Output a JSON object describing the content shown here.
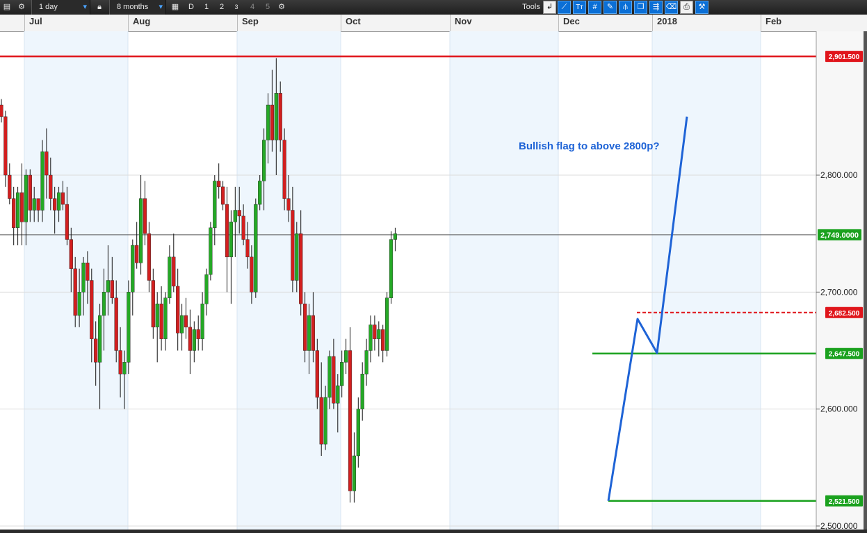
{
  "toolbar": {
    "interval": "1 day",
    "range": "8 months",
    "btn_d": "D",
    "btn_1": "1",
    "btn_2": "2",
    "btn_3": "3",
    "btn_4": "4",
    "btn_5": "5",
    "tools_label": "Tools",
    "text_tool": "Tт"
  },
  "chart_data": {
    "type": "candlestick",
    "title": "",
    "annotation": "Bullish flag to above 2800p?",
    "months": [
      "Jul",
      "Aug",
      "Sep",
      "Oct",
      "Nov",
      "Dec",
      "2018",
      "Feb"
    ],
    "y_ticks": [
      "2,800.000",
      "2,700.000",
      "2,600.000",
      "2,500.000"
    ],
    "y_tick_values": [
      2800,
      2700,
      2600,
      2500
    ],
    "ylim": [
      2497,
      2923
    ],
    "levels": [
      {
        "value": 2901.5,
        "label": "2,901.500",
        "color": "#e0151b",
        "style": "solid"
      },
      {
        "value": 2749.0,
        "label": "2,749.0000",
        "color": "#1aa11e",
        "style": "current"
      },
      {
        "value": 2682.5,
        "label": "2,682.500",
        "color": "#e0151b",
        "style": "dashed"
      },
      {
        "value": 2647.5,
        "label": "2,647.500",
        "color": "#1aa11e",
        "style": "solid"
      },
      {
        "value": 2521.5,
        "label": "2,521.500",
        "color": "#1aa11e",
        "style": "solid"
      }
    ],
    "candles": [
      [
        2860,
        2865,
        2845,
        2850
      ],
      [
        2850,
        2855,
        2790,
        2800
      ],
      [
        2800,
        2810,
        2775,
        2780
      ],
      [
        2780,
        2790,
        2740,
        2755
      ],
      [
        2755,
        2790,
        2740,
        2785
      ],
      [
        2785,
        2810,
        2740,
        2760
      ],
      [
        2760,
        2805,
        2740,
        2800
      ],
      [
        2800,
        2805,
        2760,
        2770
      ],
      [
        2770,
        2790,
        2760,
        2780
      ],
      [
        2780,
        2780,
        2760,
        2770
      ],
      [
        2770,
        2830,
        2760,
        2820
      ],
      [
        2820,
        2840,
        2780,
        2800
      ],
      [
        2800,
        2815,
        2770,
        2780
      ],
      [
        2780,
        2790,
        2750,
        2770
      ],
      [
        2770,
        2790,
        2760,
        2785
      ],
      [
        2785,
        2795,
        2770,
        2775
      ],
      [
        2775,
        2790,
        2740,
        2745
      ],
      [
        2745,
        2755,
        2700,
        2720
      ],
      [
        2720,
        2730,
        2670,
        2680
      ],
      [
        2680,
        2720,
        2670,
        2700
      ],
      [
        2700,
        2730,
        2680,
        2725
      ],
      [
        2725,
        2735,
        2690,
        2710
      ],
      [
        2710,
        2720,
        2640,
        2660
      ],
      [
        2660,
        2675,
        2620,
        2640
      ],
      [
        2640,
        2690,
        2600,
        2680
      ],
      [
        2680,
        2720,
        2650,
        2700
      ],
      [
        2700,
        2740,
        2680,
        2710
      ],
      [
        2710,
        2730,
        2690,
        2695
      ],
      [
        2695,
        2710,
        2640,
        2650
      ],
      [
        2650,
        2670,
        2610,
        2630
      ],
      [
        2630,
        2650,
        2600,
        2640
      ],
      [
        2640,
        2710,
        2630,
        2700
      ],
      [
        2700,
        2745,
        2680,
        2740
      ],
      [
        2740,
        2760,
        2720,
        2725
      ],
      [
        2725,
        2800,
        2715,
        2780
      ],
      [
        2780,
        2795,
        2740,
        2750
      ],
      [
        2750,
        2760,
        2700,
        2710
      ],
      [
        2710,
        2720,
        2660,
        2670
      ],
      [
        2670,
        2700,
        2640,
        2690
      ],
      [
        2690,
        2705,
        2650,
        2660
      ],
      [
        2660,
        2700,
        2650,
        2695
      ],
      [
        2695,
        2740,
        2690,
        2730
      ],
      [
        2730,
        2750,
        2700,
        2705
      ],
      [
        2705,
        2720,
        2650,
        2665
      ],
      [
        2665,
        2690,
        2650,
        2680
      ],
      [
        2680,
        2695,
        2660,
        2670
      ],
      [
        2670,
        2685,
        2630,
        2650
      ],
      [
        2650,
        2675,
        2640,
        2668
      ],
      [
        2668,
        2680,
        2650,
        2660
      ],
      [
        2660,
        2700,
        2650,
        2690
      ],
      [
        2690,
        2720,
        2680,
        2715
      ],
      [
        2715,
        2760,
        2710,
        2755
      ],
      [
        2755,
        2800,
        2740,
        2795
      ],
      [
        2795,
        2810,
        2780,
        2790
      ],
      [
        2790,
        2795,
        2770,
        2775
      ],
      [
        2775,
        2790,
        2700,
        2730
      ],
      [
        2730,
        2770,
        2690,
        2760
      ],
      [
        2760,
        2790,
        2730,
        2770
      ],
      [
        2770,
        2790,
        2750,
        2765
      ],
      [
        2765,
        2775,
        2740,
        2745
      ],
      [
        2745,
        2760,
        2720,
        2730
      ],
      [
        2730,
        2740,
        2690,
        2700
      ],
      [
        2700,
        2780,
        2695,
        2775
      ],
      [
        2775,
        2800,
        2770,
        2795
      ],
      [
        2795,
        2840,
        2770,
        2830
      ],
      [
        2830,
        2870,
        2810,
        2860
      ],
      [
        2860,
        2890,
        2820,
        2830
      ],
      [
        2830,
        2900,
        2800,
        2870
      ],
      [
        2870,
        2880,
        2820,
        2830
      ],
      [
        2830,
        2840,
        2770,
        2780
      ],
      [
        2780,
        2800,
        2760,
        2770
      ],
      [
        2770,
        2790,
        2700,
        2710
      ],
      [
        2710,
        2760,
        2700,
        2750
      ],
      [
        2750,
        2770,
        2680,
        2690
      ],
      [
        2690,
        2700,
        2640,
        2650
      ],
      [
        2650,
        2690,
        2630,
        2680
      ],
      [
        2680,
        2700,
        2640,
        2650
      ],
      [
        2650,
        2660,
        2600,
        2610
      ],
      [
        2610,
        2640,
        2560,
        2570
      ],
      [
        2570,
        2620,
        2565,
        2610
      ],
      [
        2610,
        2650,
        2600,
        2645
      ],
      [
        2645,
        2660,
        2600,
        2605
      ],
      [
        2605,
        2630,
        2580,
        2620
      ],
      [
        2620,
        2650,
        2610,
        2640
      ],
      [
        2640,
        2660,
        2630,
        2650
      ],
      [
        2650,
        2670,
        2520,
        2530
      ],
      [
        2530,
        2580,
        2520,
        2560
      ],
      [
        2560,
        2610,
        2550,
        2600
      ],
      [
        2600,
        2640,
        2590,
        2630
      ],
      [
        2630,
        2660,
        2620,
        2650
      ],
      [
        2650,
        2680,
        2640,
        2672
      ],
      [
        2672,
        2680,
        2650,
        2660
      ],
      [
        2660,
        2675,
        2645,
        2668
      ],
      [
        2668,
        2672,
        2640,
        2650
      ],
      [
        2650,
        2700,
        2645,
        2695
      ],
      [
        2695,
        2752,
        2690,
        2745
      ],
      [
        2745,
        2755,
        2735,
        2750
      ]
    ],
    "trend_lines": [
      {
        "points": [
          [
            2521.5,
            875
          ],
          [
            2677,
            917
          ],
          [
            2648,
            945
          ],
          [
            2850,
            988
          ]
        ],
        "color": "#1e63d6"
      }
    ],
    "xlabel": "",
    "ylabel": ""
  }
}
